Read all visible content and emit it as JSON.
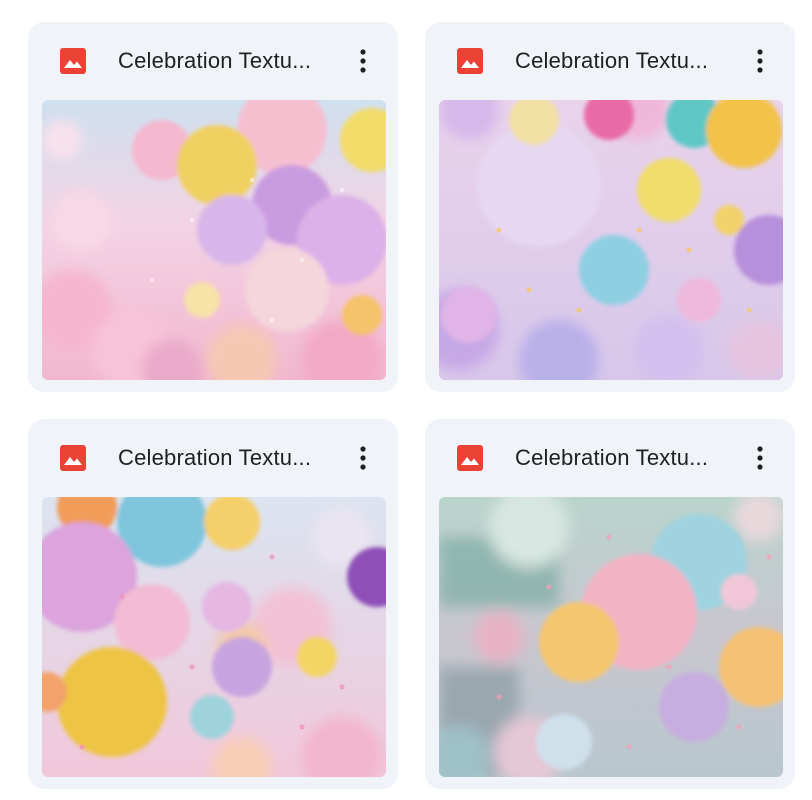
{
  "files": [
    {
      "name": "Celebration Textu...",
      "type_icon": "image-file-icon",
      "menu_icon": "more-vert-icon"
    },
    {
      "name": "Celebration Textu...",
      "type_icon": "image-file-icon",
      "menu_icon": "more-vert-icon"
    },
    {
      "name": "Celebration Textu...",
      "type_icon": "image-file-icon",
      "menu_icon": "more-vert-icon"
    },
    {
      "name": "Celebration Textu...",
      "type_icon": "image-file-icon",
      "menu_icon": "more-vert-icon"
    }
  ],
  "colors": {
    "card_background": "#f0f4f9",
    "image_icon_red": "#ea4335",
    "text": "#1f1f1f"
  }
}
